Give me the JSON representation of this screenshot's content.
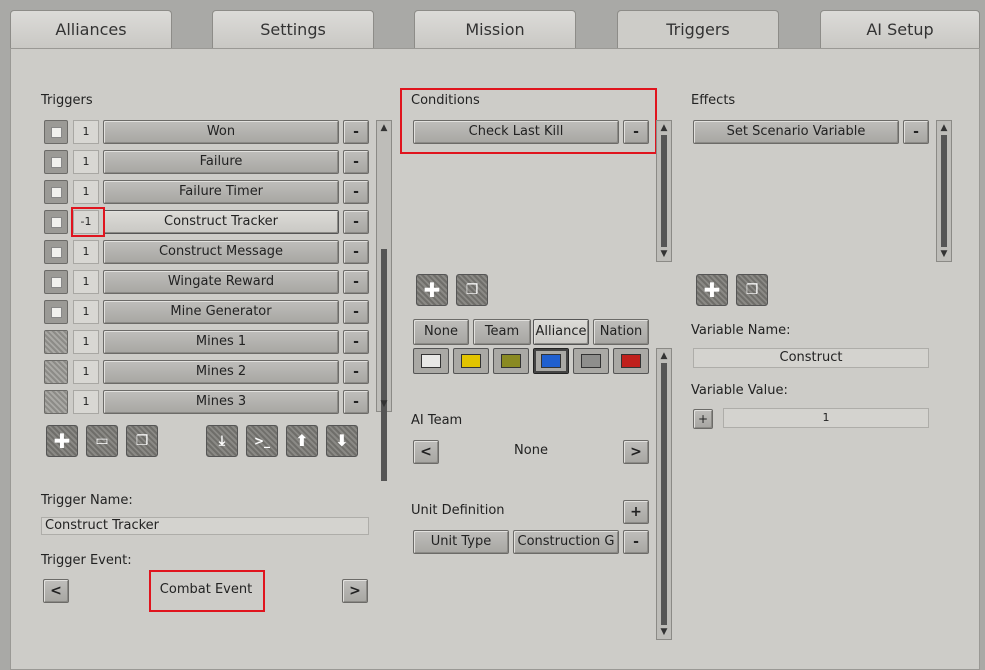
{
  "tabs": [
    "Alliances",
    "Settings",
    "Mission",
    "Triggers",
    "AI Setup"
  ],
  "triggers": {
    "header": "Triggers",
    "items": [
      {
        "count": "1",
        "label": "Won"
      },
      {
        "count": "1",
        "label": "Failure"
      },
      {
        "count": "1",
        "label": "Failure Timer"
      },
      {
        "count": "-1",
        "label": "Construct Tracker"
      },
      {
        "count": "1",
        "label": "Construct Message"
      },
      {
        "count": "1",
        "label": "Wingate Reward"
      },
      {
        "count": "1",
        "label": "Mine Generator"
      },
      {
        "count": "1",
        "label": "Mines 1"
      },
      {
        "count": "1",
        "label": "Mines 2"
      },
      {
        "count": "1",
        "label": "Mines 3"
      }
    ],
    "remove_label": "-",
    "name_label": "Trigger Name:",
    "name_value": "Construct Tracker",
    "event_label": "Trigger Event:",
    "event_value": "Combat Event",
    "prev": "<",
    "next": ">"
  },
  "conditions": {
    "header": "Conditions",
    "items": [
      "Check Last Kill"
    ],
    "remove_label": "-",
    "team_buttons": [
      "None",
      "Team",
      "Alliance",
      "Nation"
    ],
    "colors": [
      "#e8e8e6",
      "#e2c400",
      "#8a8a22",
      "#1f5fcf",
      "#8e8e8c",
      "#c0201c"
    ],
    "ai_team_label": "AI Team",
    "ai_team_value": "None",
    "prev": "<",
    "next": ">",
    "unit_def_label": "Unit Definition",
    "add": "+",
    "unit_type": "Unit Type",
    "unit_value": "Construction G",
    "minus": "-"
  },
  "effects": {
    "header": "Effects",
    "items": [
      "Set Scenario Variable"
    ],
    "remove_label": "-",
    "var_name_label": "Variable Name:",
    "var_name_value": "Construct",
    "var_value_label": "Variable Value:",
    "plus": "+",
    "var_value": "1"
  }
}
